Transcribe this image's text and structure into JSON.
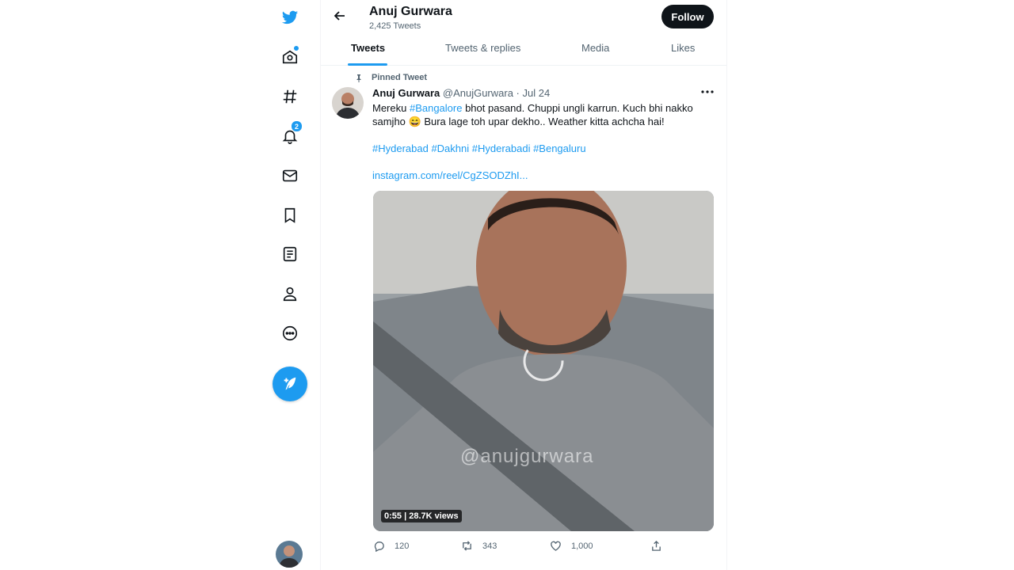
{
  "sidebar": {
    "items": [
      {
        "name": "twitter-logo-icon"
      },
      {
        "name": "home-icon"
      },
      {
        "name": "explore-hashtag-icon"
      },
      {
        "name": "notifications-icon",
        "badge": "2"
      },
      {
        "name": "messages-icon"
      },
      {
        "name": "bookmarks-icon"
      },
      {
        "name": "lists-icon"
      },
      {
        "name": "profile-icon"
      },
      {
        "name": "more-icon"
      }
    ],
    "compose_icon": "compose-tweet-icon"
  },
  "header": {
    "name": "Anuj Gurwara",
    "tweet_count": "2,425 Tweets",
    "follow_label": "Follow"
  },
  "tabs": [
    {
      "label": "Tweets",
      "active": true
    },
    {
      "label": "Tweets & replies"
    },
    {
      "label": "Media"
    },
    {
      "label": "Likes"
    }
  ],
  "tweet": {
    "pinned_label": "Pinned Tweet",
    "author_name": "Anuj Gurwara",
    "handle_date": "@AnujGurwara · Jul 24",
    "text_1": "Mereku ",
    "text_hashtag": "#Bangalore",
    "text_2": " bhot pasand. Chuppi ungli karrun. Kuch bhi nakko samjho 😄 Bura lage toh upar dekho.. Weather kitta achcha hai!",
    "hashtags": "#Hyderabad #Dakhni #Hyderabadi #Bengaluru",
    "link": "instagram.com/reel/CgZSODZhI...",
    "video": {
      "watermark": "@anujgurwara",
      "duration_views": "0:55 | 28.7K views"
    },
    "stats": {
      "replies": "120",
      "retweets": "343",
      "likes": "1,000"
    }
  },
  "colors": {
    "accent": "#1d9bf0",
    "text": "#0f1419",
    "muted": "#536471",
    "follow_bg": "#0f1419"
  }
}
